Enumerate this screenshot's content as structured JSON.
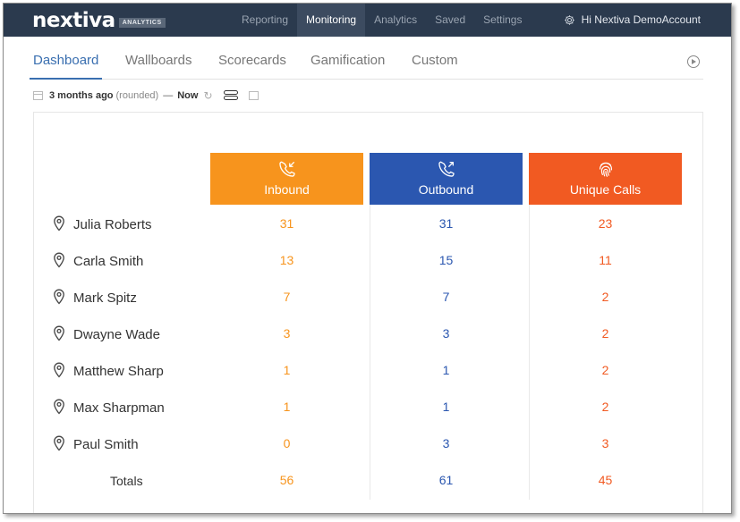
{
  "app": {
    "logo_text": "nextiva",
    "logo_badge": "ANALYTICS"
  },
  "nav": {
    "items": [
      {
        "label": "Reporting"
      },
      {
        "label": "Monitoring"
      },
      {
        "label": "Analytics"
      },
      {
        "label": "Saved"
      },
      {
        "label": "Settings"
      }
    ],
    "active": "Monitoring",
    "user_greeting": "Hi Nextiva DemoAccount"
  },
  "tabs": [
    {
      "label": "Dashboard"
    },
    {
      "label": "Wallboards"
    },
    {
      "label": "Scorecards"
    },
    {
      "label": "Gamification"
    },
    {
      "label": "Custom"
    }
  ],
  "time_range": {
    "from": "3 months ago",
    "from_note": "(rounded)",
    "separator": "—",
    "to": "Now"
  },
  "table": {
    "columns": [
      {
        "label": "Inbound",
        "icon": "incoming-call-icon",
        "color": "#f7941d"
      },
      {
        "label": "Outbound",
        "icon": "outgoing-call-icon",
        "color": "#2b57b0"
      },
      {
        "label": "Unique Calls",
        "icon": "fingerprint-icon",
        "color": "#f15a22"
      }
    ],
    "rows": [
      {
        "name": "Julia Roberts",
        "inbound": "31",
        "outbound": "31",
        "unique": "23"
      },
      {
        "name": "Carla Smith",
        "inbound": "13",
        "outbound": "15",
        "unique": "11"
      },
      {
        "name": "Mark Spitz",
        "inbound": "7",
        "outbound": "7",
        "unique": "2"
      },
      {
        "name": "Dwayne Wade",
        "inbound": "3",
        "outbound": "3",
        "unique": "2"
      },
      {
        "name": "Matthew Sharp",
        "inbound": "1",
        "outbound": "1",
        "unique": "2"
      },
      {
        "name": "Max Sharpman",
        "inbound": "1",
        "outbound": "1",
        "unique": "2"
      },
      {
        "name": "Paul Smith",
        "inbound": "0",
        "outbound": "3",
        "unique": "3"
      }
    ],
    "totals": {
      "label": "Totals",
      "inbound": "56",
      "outbound": "61",
      "unique": "45"
    }
  }
}
